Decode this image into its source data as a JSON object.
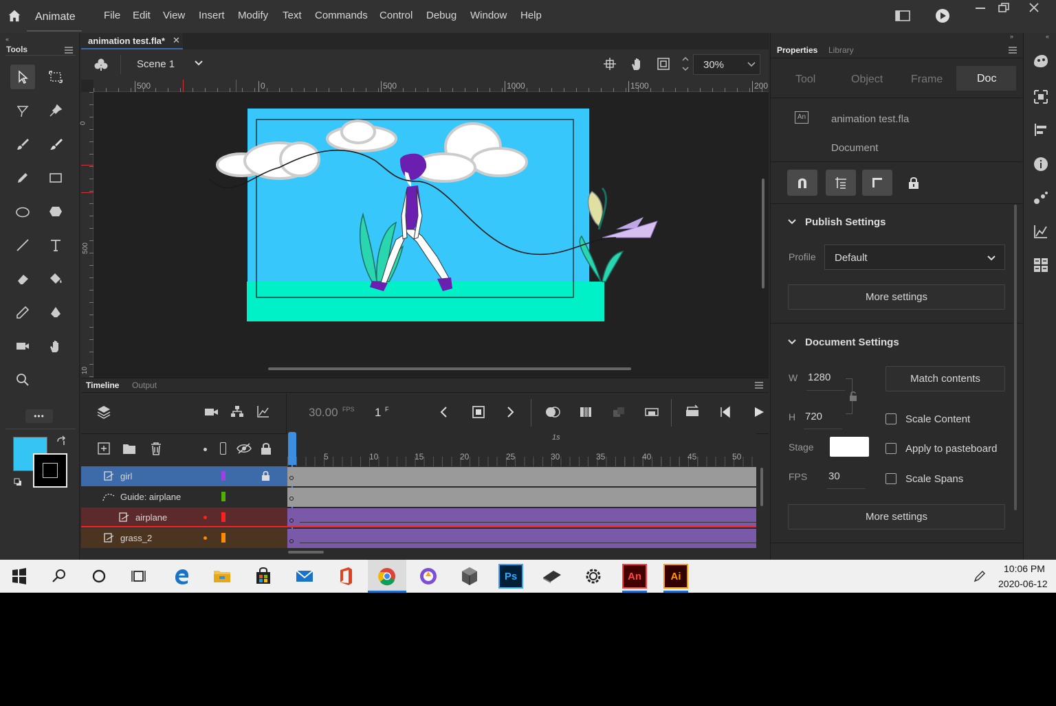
{
  "app": {
    "name": "Animate"
  },
  "menu": [
    "File",
    "Edit",
    "View",
    "Insert",
    "Modify",
    "Text",
    "Commands",
    "Control",
    "Debug",
    "Window",
    "Help"
  ],
  "tools": {
    "title": "Tools",
    "more": "•••"
  },
  "document": {
    "tab_title": "animation test.fla*",
    "scene": "Scene 1",
    "zoom": "30%",
    "ruler_h": [
      "500",
      "0",
      "500",
      "1000",
      "1500",
      "200"
    ],
    "ruler_v": [
      "0",
      "500",
      "10"
    ]
  },
  "timeline": {
    "tabs": [
      "Timeline",
      "Output"
    ],
    "fps": "30.00",
    "fps_unit": "FPS",
    "frame": "1",
    "frame_unit": "F",
    "second_marker": "1s",
    "frame_ticks": [
      "5",
      "10",
      "15",
      "20",
      "25",
      "30",
      "35",
      "40",
      "45",
      "50"
    ],
    "layers": [
      {
        "name": "girl",
        "color": "#a040e0",
        "locked": true,
        "selected": true
      },
      {
        "name": "Guide: airplane",
        "color": "#50b000",
        "guide": true
      },
      {
        "name": "airplane",
        "color": "#ff2020",
        "guided": true
      },
      {
        "name": "grass_2",
        "color": "#ff8c00"
      }
    ]
  },
  "properties": {
    "tabs": [
      "Properties",
      "Library"
    ],
    "subtabs": [
      "Tool",
      "Object",
      "Frame",
      "Doc"
    ],
    "file_name": "animation test.fla",
    "file_type": "Document",
    "publish": {
      "title": "Publish Settings",
      "profile_label": "Profile",
      "profile_value": "Default",
      "more": "More settings"
    },
    "doc_settings": {
      "title": "Document Settings",
      "w_label": "W",
      "w_value": "1280",
      "h_label": "H",
      "h_value": "720",
      "match": "Match contents",
      "scale_content": "Scale Content",
      "stage_label": "Stage",
      "apply_pasteboard": "Apply to pasteboard",
      "fps_label": "FPS",
      "fps_value": "30",
      "scale_spans": "Scale Spans",
      "more": "More settings"
    }
  },
  "taskbar": {
    "time": "10:06 PM",
    "date": "2020-06-12",
    "ps_label": "Ps",
    "an_label": "An",
    "ai_label": "Ai"
  },
  "colors": {
    "stage_sky": "#38c7fa",
    "stage_ground": "#00f0c8",
    "accent": "#3d6aa8",
    "fill_swatch": "#35c5f5"
  }
}
